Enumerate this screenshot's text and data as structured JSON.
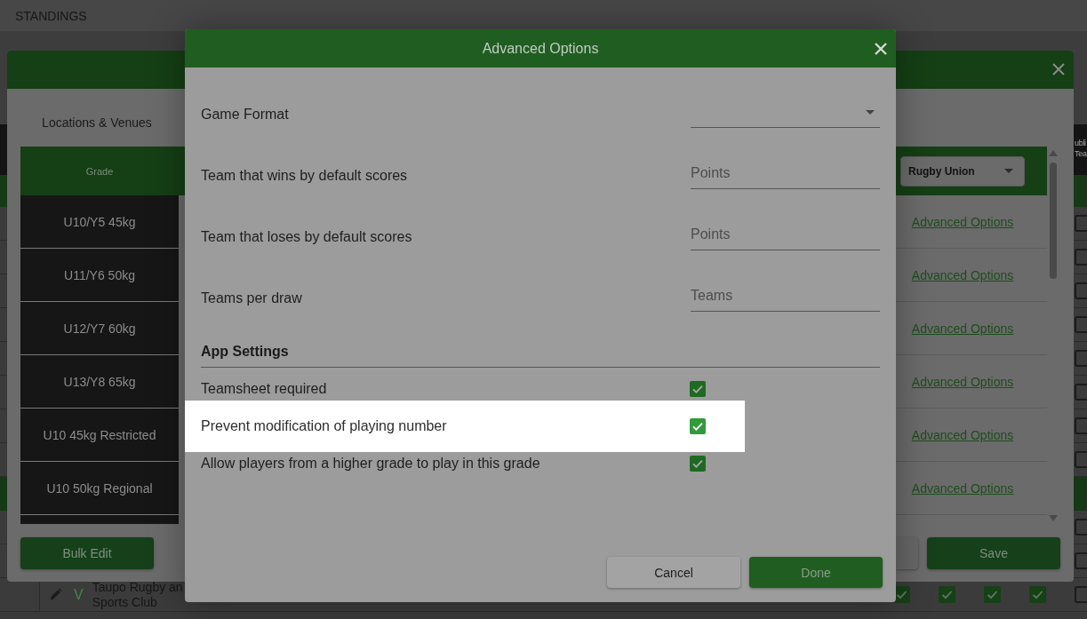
{
  "page": {
    "title": "STANDINGS",
    "table": {
      "header_fragment": [
        "ubli",
        "Tea"
      ],
      "rows": [
        {
          "kind": "row",
          "checks": [
            {
              "checked": false
            }
          ]
        },
        {
          "kind": "row",
          "checks": [
            {
              "checked": false
            }
          ]
        },
        {
          "kind": "row",
          "checks": [
            {
              "checked": false
            }
          ]
        },
        {
          "kind": "row",
          "checks": [
            {
              "checked": false
            }
          ]
        },
        {
          "kind": "row",
          "checks": [
            {
              "checked": false
            }
          ]
        },
        {
          "kind": "row",
          "checks": [
            {
              "checked": false
            }
          ]
        },
        {
          "kind": "row",
          "checks": [
            {
              "checked": false
            }
          ]
        },
        {
          "kind": "row",
          "checks": [
            {
              "checked": false
            }
          ]
        },
        {
          "kind": "group"
        },
        {
          "kind": "row",
          "checks": [
            {
              "checked": false
            }
          ]
        },
        {
          "kind": "row",
          "checks": [
            {
              "checked": false
            }
          ]
        },
        {
          "kind": "team",
          "code": "V",
          "club": [
            "Taupo Rugby an",
            "Sports Club"
          ],
          "checks": [
            {
              "checked": true
            },
            {
              "checked": true
            },
            {
              "checked": true
            },
            {
              "checked": true
            },
            {
              "checked": false
            }
          ]
        }
      ]
    }
  },
  "grades_dialog": {
    "tabs": [
      {
        "label": "Locations & Venues",
        "selected": false
      }
    ],
    "grade_header": "Grade",
    "sport_select": {
      "value": "Rugby Union"
    },
    "rows": [
      {
        "grade": "U10/Y5 45kg",
        "link": "Advanced Options"
      },
      {
        "grade": "U11/Y6 50kg",
        "link": "Advanced Options"
      },
      {
        "grade": "U12/Y7 60kg",
        "link": "Advanced Options"
      },
      {
        "grade": "U13/Y8 65kg",
        "link": "Advanced Options"
      },
      {
        "grade": "U10 45kg Restricted",
        "link": "Advanced Options"
      },
      {
        "grade": "U10 50kg Regional",
        "link": "Advanced Options"
      }
    ],
    "buttons": [
      {
        "label": "Bulk Edit",
        "kind": "primary"
      },
      {
        "kind": "secondary"
      },
      {
        "label": "Save",
        "kind": "primary"
      }
    ]
  },
  "advanced_options": {
    "title": "Advanced Options",
    "fields": [
      {
        "label": "Game Format",
        "kind": "select"
      },
      {
        "label": "Team that wins by default scores",
        "kind": "input",
        "placeholder": "Points"
      },
      {
        "label": "Team that loses by default scores",
        "kind": "input",
        "placeholder": "Points"
      },
      {
        "label": "Teams per draw",
        "kind": "input",
        "placeholder": "Teams"
      }
    ],
    "app_settings": {
      "heading": "App Settings",
      "items": [
        {
          "label": "Teamsheet required",
          "checked": true,
          "highlighted": false
        },
        {
          "label": "Prevent modification of playing number",
          "checked": true,
          "highlighted": true
        },
        {
          "label": "Allow players from a higher grade to play in this grade",
          "checked": true,
          "highlighted": false
        }
      ]
    },
    "buttons": [
      {
        "label": "Cancel",
        "kind": "secondary"
      },
      {
        "label": "Done",
        "kind": "primary"
      }
    ]
  }
}
